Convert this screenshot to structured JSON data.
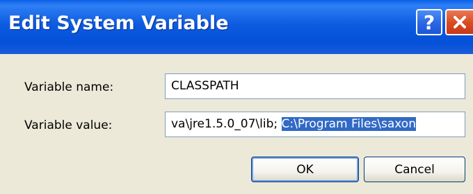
{
  "window": {
    "title": "Edit System Variable",
    "help_label": "?"
  },
  "form": {
    "name_label": "Variable name:",
    "name_value": "CLASSPATH",
    "value_label": "Variable value:",
    "value_text_plain": "va\\jre1.5.0_07\\lib; ",
    "value_text_selected": "C:\\Program Files\\saxon"
  },
  "buttons": {
    "ok_label": "OK",
    "cancel_label": "Cancel"
  },
  "colors": {
    "titlebar": "#0450D8",
    "dialog_bg": "#ECE9D8",
    "selection": "#316AC5",
    "close_button": "#D84A1F"
  }
}
